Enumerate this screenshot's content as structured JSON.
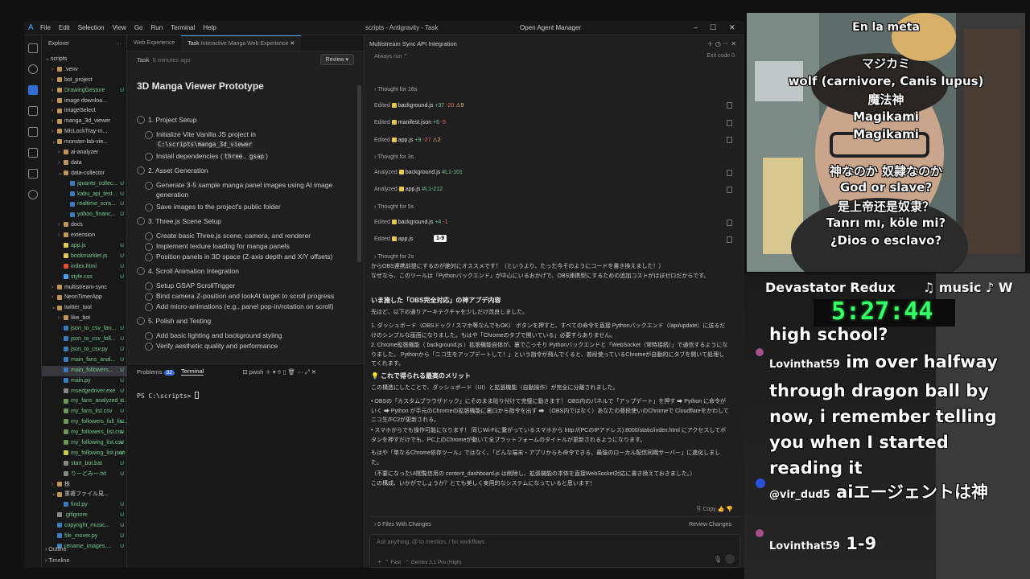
{
  "ide": {
    "menu": [
      "File",
      "Edit",
      "Selection",
      "View",
      "Go",
      "Run",
      "Terminal",
      "Help"
    ],
    "window_title": "scripts - Antigravity - Task",
    "open_agent_manager": "Open Agent Manager",
    "explorer_label": "Explorer",
    "tree": [
      {
        "name": "scripts",
        "kind": "root"
      },
      {
        "name": ".venv",
        "kind": "folder",
        "depth": 1
      },
      {
        "name": "bot_project",
        "kind": "folder",
        "depth": 1
      },
      {
        "name": "DrawingGesture",
        "kind": "folder",
        "depth": 1,
        "mark": "U"
      },
      {
        "name": "image downloa...",
        "kind": "folder",
        "depth": 1
      },
      {
        "name": "imageSelect",
        "kind": "folder",
        "depth": 1
      },
      {
        "name": "manga_3d_viewer",
        "kind": "folder",
        "depth": 1
      },
      {
        "name": "MicLockTray-m...",
        "kind": "folder",
        "depth": 1
      },
      {
        "name": "monster-lab-vie...",
        "kind": "folder",
        "depth": 1,
        "open": true
      },
      {
        "name": "ai-analyzer",
        "kind": "folder",
        "depth": 2
      },
      {
        "name": "data",
        "kind": "folder",
        "depth": 2
      },
      {
        "name": "data-collector",
        "kind": "folder",
        "depth": 2,
        "open": true
      },
      {
        "name": "jquants_collec...",
        "kind": "py",
        "depth": 3,
        "mark": "U"
      },
      {
        "name": "kabu_api_test...",
        "kind": "py",
        "depth": 3,
        "mark": "U"
      },
      {
        "name": "realtime_scra...",
        "kind": "py",
        "depth": 3,
        "mark": "U"
      },
      {
        "name": "yahoo_financ...",
        "kind": "py",
        "depth": 3,
        "mark": "U"
      },
      {
        "name": "docs",
        "kind": "folder",
        "depth": 2
      },
      {
        "name": "extension",
        "kind": "folder",
        "depth": 2
      },
      {
        "name": "app.js",
        "kind": "js",
        "depth": 2,
        "mark": "U"
      },
      {
        "name": "bookmarklet.js",
        "kind": "js",
        "depth": 2,
        "mark": "U"
      },
      {
        "name": "index.html",
        "kind": "html",
        "depth": 2,
        "mark": "U"
      },
      {
        "name": "style.css",
        "kind": "css",
        "depth": 2,
        "mark": "U"
      },
      {
        "name": "multistream-sync",
        "kind": "folder",
        "depth": 1
      },
      {
        "name": "NeonTimerApp",
        "kind": "folder",
        "depth": 1
      },
      {
        "name": "twitter_tool",
        "kind": "folder",
        "depth": 1,
        "open": true
      },
      {
        "name": "like_bot",
        "kind": "folder",
        "depth": 2
      },
      {
        "name": "json_to_csv_fan...",
        "kind": "py",
        "depth": 2,
        "mark": "U"
      },
      {
        "name": "json_to_csv_foll...",
        "kind": "py",
        "depth": 2,
        "mark": "U"
      },
      {
        "name": "json_to_csv.py",
        "kind": "py",
        "depth": 2,
        "mark": "U"
      },
      {
        "name": "main_fans_anal...",
        "kind": "py",
        "depth": 2,
        "mark": "U"
      },
      {
        "name": "main_followers...",
        "kind": "py",
        "depth": 2,
        "mark": "U",
        "selected": true
      },
      {
        "name": "main.py",
        "kind": "py",
        "depth": 2,
        "mark": "U"
      },
      {
        "name": "msedgedriver.exe",
        "kind": "txt",
        "depth": 2,
        "mark": "U"
      },
      {
        "name": "my_fans_analyzed_r...",
        "kind": "csv",
        "depth": 2,
        "mark": "U"
      },
      {
        "name": "my_fans_list.csv",
        "kind": "csv",
        "depth": 2,
        "mark": "U"
      },
      {
        "name": "my_followers_full_lis...",
        "kind": "csv",
        "depth": 2,
        "mark": "U"
      },
      {
        "name": "my_followers_list.csv",
        "kind": "csv",
        "depth": 2,
        "mark": "U"
      },
      {
        "name": "my_following_list.csv",
        "kind": "csv",
        "depth": 2,
        "mark": "U"
      },
      {
        "name": "my_following_list.json",
        "kind": "json",
        "depth": 2,
        "mark": "U"
      },
      {
        "name": "start_bot.bat",
        "kind": "txt",
        "depth": 2,
        "mark": "U"
      },
      {
        "name": "りーどみー.txt",
        "kind": "txt",
        "depth": 2,
        "mark": "U"
      },
      {
        "name": "株",
        "kind": "folder",
        "depth": 1
      },
      {
        "name": "重複ファイル見...",
        "kind": "folder",
        "depth": 1,
        "open": true
      },
      {
        "name": "find.py",
        "kind": "py",
        "depth": 2,
        "mark": "U"
      },
      {
        "name": ".gitignore",
        "kind": "txt",
        "depth": 1,
        "mark": "U"
      },
      {
        "name": "copyright_music...",
        "kind": "py",
        "depth": 1,
        "mark": "U"
      },
      {
        "name": "file_mover.py",
        "kind": "py",
        "depth": 1,
        "mark": "U"
      },
      {
        "name": "rename_images....",
        "kind": "py",
        "depth": 1,
        "mark": "U"
      }
    ],
    "outline": "Outline",
    "timeline": "Timeline",
    "tabs": [
      "Web Experience",
      "Task",
      "Interactive Manga Web Experience"
    ],
    "task": {
      "label": "Task",
      "time": "5 minutes ago",
      "review": "Review",
      "title": "3D Manga Viewer Prototype",
      "sections": [
        {
          "title": "1. Project Setup",
          "items": [
            "Initialize Vite Vanilla JS project in",
            "Install dependencies ("
          ]
        },
        {
          "title": "2. Asset Generation",
          "items": [
            "Generate 3-5 sample manga panel images using AI image generation",
            "Save images to the project's public folder"
          ]
        },
        {
          "title": "3. Three.js Scene Setup",
          "items": [
            "Create basic Three.js scene, camera, and renderer",
            "Implement texture loading for manga panels",
            "Position panels in 3D space (Z-axis depth and X/Y offsets)"
          ]
        },
        {
          "title": "4. Scroll Animation Integration",
          "items": [
            "Setup GSAP ScrollTrigger",
            "Bind camera Z-position and lookAt target to scroll progress",
            "Add micro-animations (e.g., panel pop-in/rotation on scroll)"
          ]
        },
        {
          "title": "5. Polish and Testing",
          "items": [
            "Add basic lighting and background styling",
            "Verify aesthetic quality and performance"
          ]
        }
      ],
      "path_code": "C:\\scripts\\manga_3d_viewer",
      "dep1": "three",
      "dep2": "gsap"
    },
    "terminal": {
      "problems": "Problems",
      "problems_count": "32",
      "terminal": "Terminal",
      "shell": "pwsh",
      "prompt": "PS C:\\scripts> "
    },
    "agent": {
      "title": "Multistream Sync API Integration",
      "runs": "Always run",
      "exit": "Exit code 0",
      "rows": [
        {
          "type": "thought",
          "text": "Thought for 16s"
        },
        {
          "type": "edit",
          "verb": "Edited",
          "file": "background.js",
          "add": "+37",
          "del": "-20",
          "warn": "9"
        },
        {
          "type": "edit",
          "verb": "Edited",
          "file": "manifest.json",
          "add": "+6",
          "del": "-5",
          "warn": ""
        },
        {
          "type": "edit",
          "verb": "Edited",
          "file": "app.js",
          "add": "+9",
          "del": "-27",
          "warn": "2"
        },
        {
          "type": "thought",
          "text": "Thought for 3s"
        },
        {
          "type": "edit",
          "verb": "Analyzed",
          "file": "background.js",
          "add": "#L1-101",
          "del": "",
          "warn": ""
        },
        {
          "type": "edit",
          "verb": "Analyzed",
          "file": "app.js",
          "add": "#L1-212",
          "del": "",
          "warn": ""
        },
        {
          "type": "thought",
          "text": "Thought for 5s"
        },
        {
          "type": "edit",
          "verb": "Edited",
          "file": "background.js",
          "add": "+4",
          "del": "-1",
          "warn": ""
        },
        {
          "type": "edit",
          "verb": "Edited",
          "file": "app.js",
          "add": "",
          "del": "",
          "warn": ""
        },
        {
          "type": "thought",
          "text": "Thought for 2s"
        }
      ],
      "tooltip": "1-9",
      "p1": "からOBS連携前提にするのが絶対にオススメです！（というより、たった今そのようにコードを書き換えました！）",
      "p1b": "なぜなら、このツールは「Pythonバックエンド」が中心にいるおかげで、OBS連携型にするための追加コストがほぼゼロだからです。",
      "h1": "いま施した「OBS完全対応」の神アプデ内容",
      "p2": "先ほど、以下の通りアーキテクチャを少しだけ改良しました。",
      "li1": "1. ダッシュボード（OBSドック / スマホ等なんでもOK） ボタンを押すと、すべての命令を直接 Pythonバックエンド（/api/update）に送るだけのシンプルな画面になりました。もはや「Chromeのタブで開いている」必要すらありません。",
      "li2": "2. Chrome拡張機能（ background.js ）拡張機能自体が、裏でこっそり Pythonバックエンドと「WebSocket（常時接続）」で通信するようになりました。 Pythonから「ニコ生をアップデートして！」という指令が飛んでくると、普段使っているChromeが自動的にタブを開いて処理してくれます。",
      "h2": "💡 これで得られる最高のメリット",
      "p3": "この構造にしたことで、ダッシュボード（UI）と拡張機能（自動操作）が完全に分離されました。",
      "b1": "• OBSの「カスタムブラウザドック」にそのまま貼り付けて完璧に動きます！ OBS内のパネルで「アップデート」を押す ➡ Python に命令がいく ➡ Python が手元のChromeの拡張機能に裏口から指令を出す ➡ （OBS内ではなく）あなたの普段使いのChromeで Cloudflareをかわしてニコ生/FC2が更新される。",
      "b2": "• スマホからでも操作可能になります！ 同じWi-Fiに繋がっているスマホから http://(PCのIPアドレス):8000/static/index.html にアクセスしてボタンを押すだけでも、PC上のChromeが動いて全プラットフォームのタイトルが更新されるようになります。",
      "p4": "もはや「単なるChrome依存ツール」ではなく、「どんな端末・アプリからも命令できる、最強のローカル配信同期サーバー」に進化しました。",
      "p5": "（不要になったUI閲覧信用の content_dashboard.js は削除し、拡張機能の本体を直接WebSocket対応に書き換えておきました。）",
      "p6": "この構成、いかがでしょうか？とても美しく実用的なシステムになっていると思います！",
      "copy": "Copy",
      "files_changed": "0 Files With Changes",
      "review_changes": "Review Changes",
      "placeholder": "Ask anything, @ to mention, / for workflows",
      "mode": "Fast",
      "model": "Gemini 3.1 Pro (High)"
    }
  },
  "webcam": {
    "lines": [
      "En la meta",
      "マジカミ",
      "wolf (carnivore, Canis lupus)",
      "魔法神",
      "Magikami",
      "Magikami",
      "神なのか 奴隷なのか",
      "God or slave?",
      "是上帝还是奴隶？",
      "Tanrı mı, köle mi?",
      "¿Dios o esclavo?"
    ]
  },
  "stream": {
    "game": "Devastator Redux",
    "music": "♫ music ♪ W",
    "timer": "5:27:44",
    "chat": [
      {
        "user": "",
        "text": "high school?"
      },
      {
        "user": "Lovinthat59",
        "text": "im over halfway through dragon ball by now, i remember telling you when I started reading it"
      },
      {
        "user": "@vir_dud5",
        "text": "aiエージェントは神"
      },
      {
        "user": "Lovinthat59",
        "text": "1-9"
      }
    ],
    "colors": {
      "accent": "#4aa3ff",
      "timer_green": "#33ff66",
      "added": "#73c991",
      "removed": "#e06c6c"
    }
  }
}
